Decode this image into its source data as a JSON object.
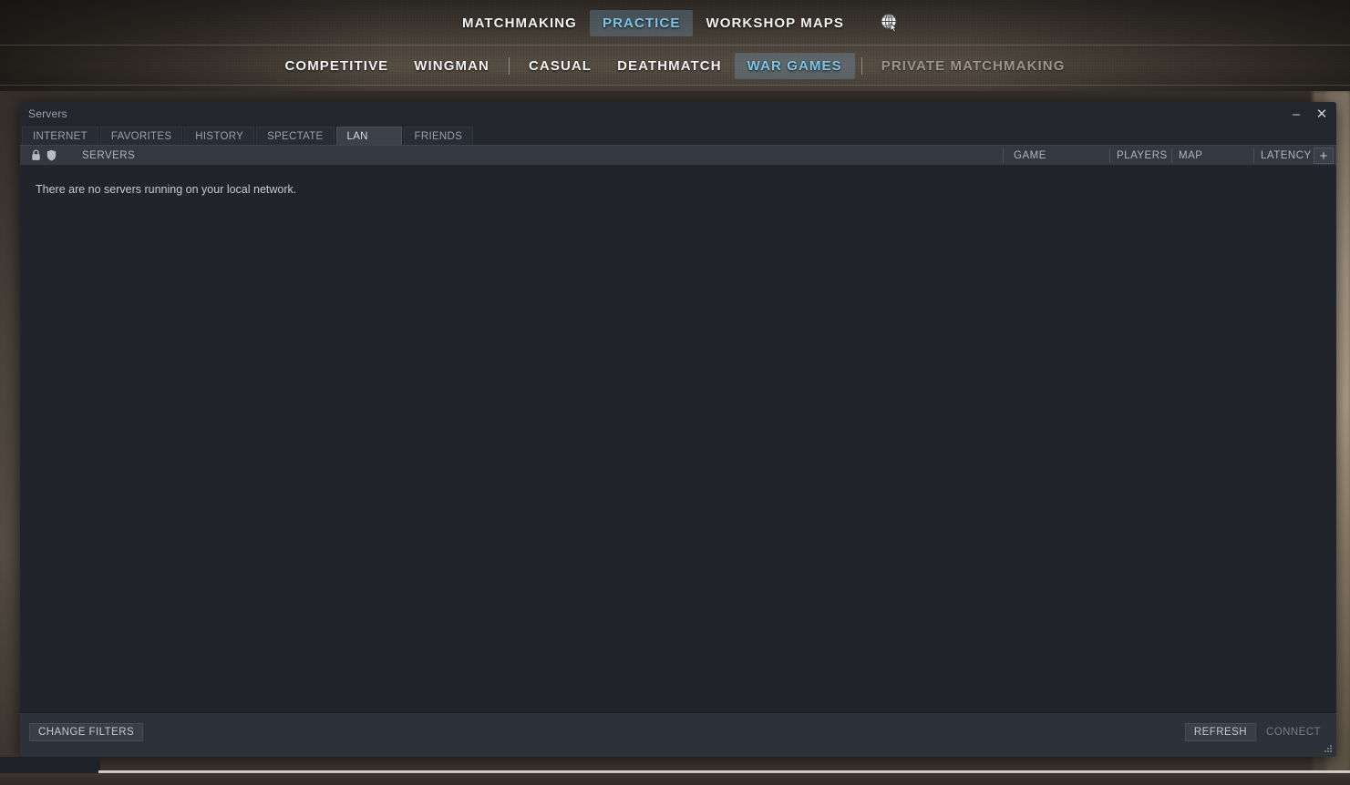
{
  "topnav": {
    "primary": [
      {
        "label": "MATCHMAKING",
        "state": "normal"
      },
      {
        "label": "PRACTICE",
        "state": "active"
      },
      {
        "label": "WORKSHOP MAPS",
        "state": "normal"
      }
    ],
    "globe_icon": "globe-cursor-icon",
    "secondary": [
      {
        "label": "COMPETITIVE",
        "state": "normal",
        "separator_after": false
      },
      {
        "label": "WINGMAN",
        "state": "normal",
        "separator_after": true
      },
      {
        "label": "CASUAL",
        "state": "normal",
        "separator_after": false
      },
      {
        "label": "DEATHMATCH",
        "state": "normal",
        "separator_after": false
      },
      {
        "label": "WAR GAMES",
        "state": "active",
        "separator_after": true
      },
      {
        "label": "PRIVATE MATCHMAKING",
        "state": "disabled",
        "separator_after": false
      }
    ],
    "accent_color": "#7ec4e8",
    "text_color": "#f2f2f2",
    "disabled_color": "#9d958c"
  },
  "dialog": {
    "title": "Servers",
    "window_controls": {
      "minimize": "–",
      "close": "✕"
    },
    "tabs": [
      {
        "label": "INTERNET",
        "active": false
      },
      {
        "label": "FAVORITES",
        "active": false
      },
      {
        "label": "HISTORY",
        "active": false
      },
      {
        "label": "SPECTATE",
        "active": false
      },
      {
        "label": "LAN",
        "active": true
      },
      {
        "label": "FRIENDS",
        "active": false
      }
    ],
    "columns": {
      "lock_icon": "padlock-icon",
      "shield_icon": "vac-shield-icon",
      "servers": "SERVERS",
      "game": "GAME",
      "players": "PLAYERS",
      "map": "MAP",
      "latency": "LATENCY",
      "latency_sort": "▲",
      "add_column": "+"
    },
    "empty_message": "There are no servers running on your local network.",
    "rows": [],
    "footer": {
      "change_filters": "CHANGE FILTERS",
      "refresh": "REFRESH",
      "connect": "CONNECT",
      "connect_enabled": false,
      "resize_grip": "resize-grip-icon"
    }
  }
}
